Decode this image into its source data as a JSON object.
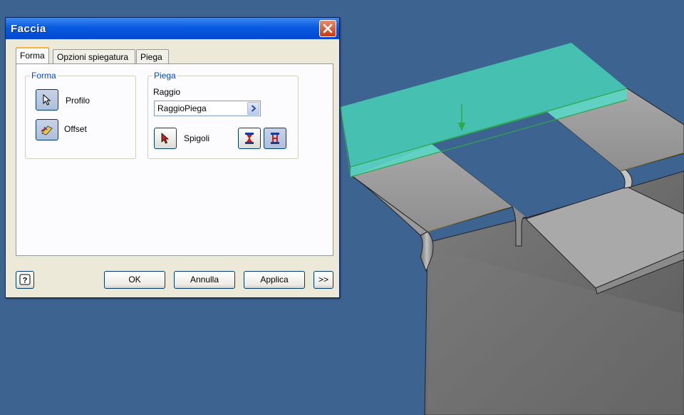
{
  "dialog": {
    "title": "Faccia",
    "tabs": [
      {
        "label": "Forma",
        "active": true
      },
      {
        "label": "Opzioni spiegatura",
        "active": false
      },
      {
        "label": "Piega",
        "active": false
      }
    ],
    "forma_group": {
      "label": "Forma",
      "profilo_label": "Profilo",
      "offset_label": "Offset"
    },
    "piega_group": {
      "label": "Piega",
      "raggio_label": "Raggio",
      "raggio_value": "RaggioPiega",
      "spigoli_label": "Spigoli"
    },
    "buttons": {
      "ok": "OK",
      "annulla": "Annulla",
      "applica": "Applica",
      "more": ">>"
    }
  },
  "colors": {
    "background": "#3d6391",
    "highlight_face": "#46c8b4",
    "part_gray": "#808080",
    "title_bar": "#0a5ae0"
  }
}
